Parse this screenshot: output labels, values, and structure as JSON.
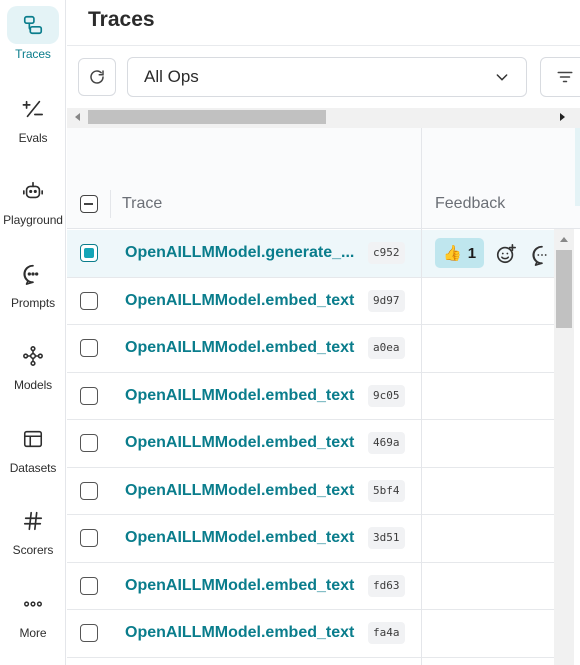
{
  "sidebar": {
    "items": [
      {
        "label": "Traces",
        "icon": "traces-icon",
        "active": true
      },
      {
        "label": "Evals",
        "icon": "evals-icon"
      },
      {
        "label": "Playground",
        "icon": "playground-icon"
      },
      {
        "label": "Prompts",
        "icon": "prompts-icon"
      },
      {
        "label": "Models",
        "icon": "models-icon"
      },
      {
        "label": "Datasets",
        "icon": "datasets-icon"
      },
      {
        "label": "Scorers",
        "icon": "scorers-icon"
      },
      {
        "label": "More",
        "icon": "more-icon"
      }
    ]
  },
  "header": {
    "title": "Traces"
  },
  "toolbar": {
    "ops_select_value": "All Ops"
  },
  "table": {
    "columns": [
      "Trace",
      "Feedback"
    ],
    "rows": [
      {
        "name": "OpenAILLMModel.generate_...",
        "id": "c952",
        "selected": true,
        "feedback_emoji": "👍",
        "feedback_count": "1"
      },
      {
        "name": "OpenAILLMModel.embed_text",
        "id": "9d97"
      },
      {
        "name": "OpenAILLMModel.embed_text",
        "id": "a0ea"
      },
      {
        "name": "OpenAILLMModel.embed_text",
        "id": "9c05"
      },
      {
        "name": "OpenAILLMModel.embed_text",
        "id": "469a"
      },
      {
        "name": "OpenAILLMModel.embed_text",
        "id": "5bf4"
      },
      {
        "name": "OpenAILLMModel.embed_text",
        "id": "3d51"
      },
      {
        "name": "OpenAILLMModel.embed_text",
        "id": "fd63"
      },
      {
        "name": "OpenAILLMModel.embed_text",
        "id": "fa4a"
      }
    ]
  },
  "colors": {
    "accent": "#0a7d8c",
    "selected_row": "#eef7fa",
    "feedback_chip": "#bfe6ee"
  }
}
